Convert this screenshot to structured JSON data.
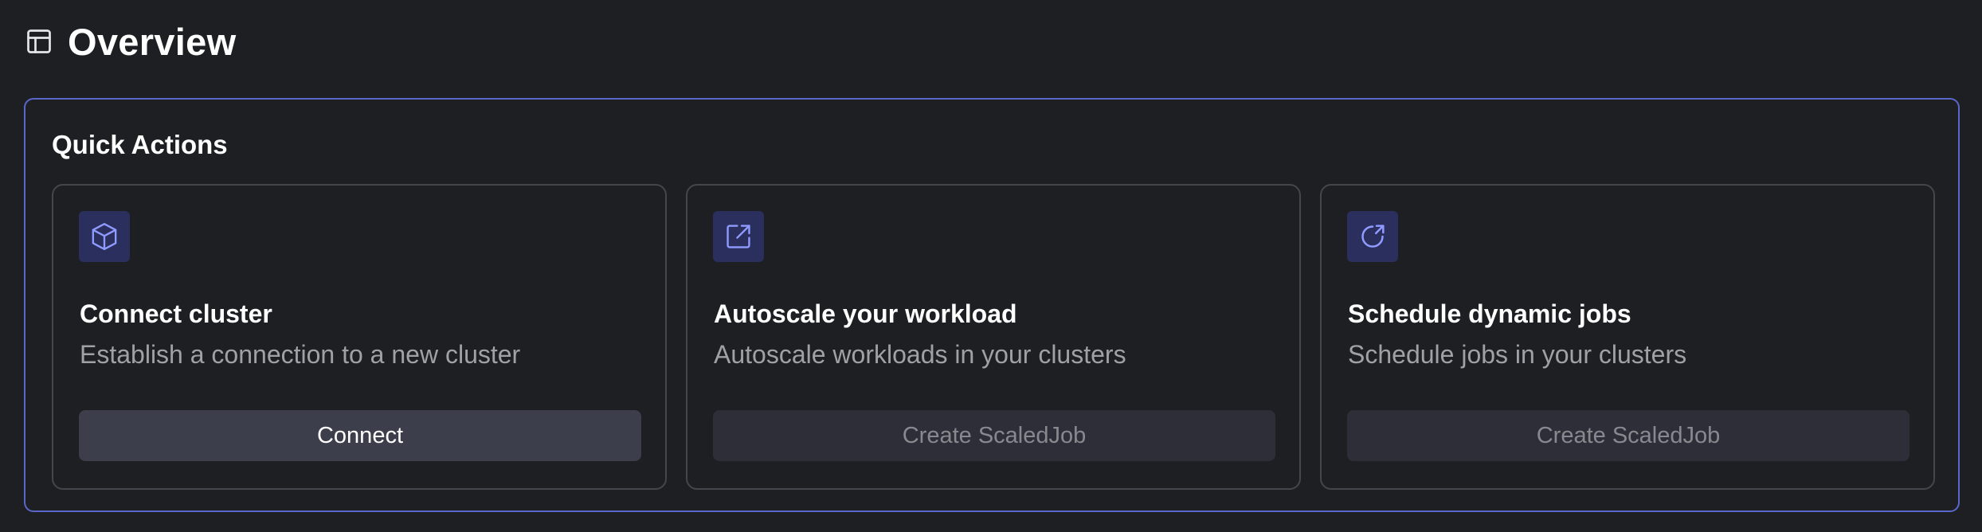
{
  "header": {
    "title": "Overview",
    "icon": "layout-icon"
  },
  "colors": {
    "background": "#1e1f23",
    "accent_border": "#5a67c9",
    "card_border": "#45464d",
    "icon_tile": "#2b2f5e",
    "icon_stroke": "#8f9bff",
    "muted_text": "#a0a1a7"
  },
  "quick_actions": {
    "title": "Quick Actions",
    "cards": [
      {
        "icon": "cube-icon",
        "title": "Connect cluster",
        "description": "Establish a connection to a new cluster",
        "button_label": "Connect",
        "button_enabled": true
      },
      {
        "icon": "external-link-icon",
        "title": "Autoscale your workload",
        "description": "Autoscale workloads in your clusters",
        "button_label": "Create ScaledJob",
        "button_enabled": false
      },
      {
        "icon": "refresh-arrow-icon",
        "title": "Schedule dynamic jobs",
        "description": "Schedule jobs in your clusters",
        "button_label": "Create ScaledJob",
        "button_enabled": false
      }
    ]
  }
}
